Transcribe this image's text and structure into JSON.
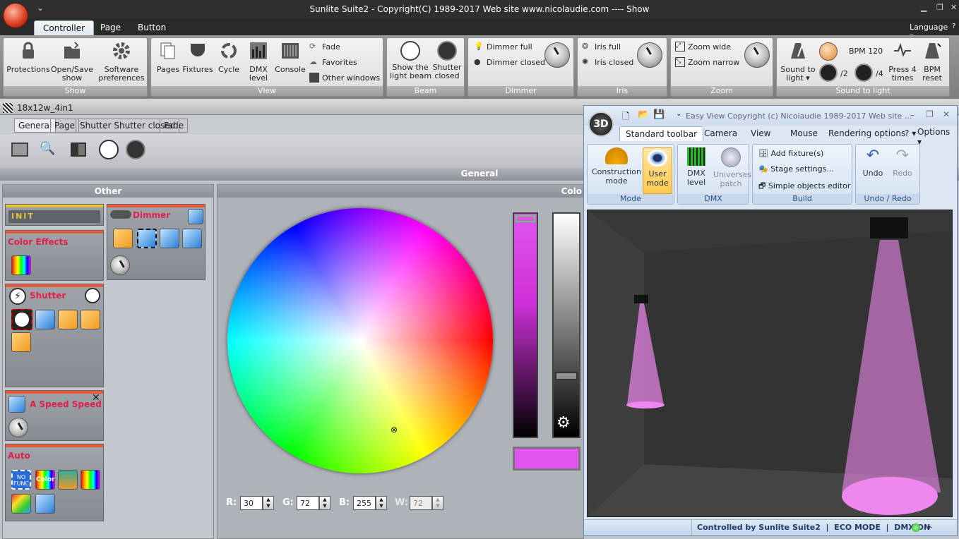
{
  "window_title": "Sunlite Suite2 - Copyright(C) 1989-2017    Web site www.nicolaudie.com ---- Show",
  "tabs": [
    "Controller",
    "Page",
    "Button"
  ],
  "language": "Language",
  "ribbon": {
    "show": {
      "label": "Show",
      "protections": "Protections",
      "open_save": "Open/Save\nshow",
      "software": "Software\npreferences"
    },
    "view": {
      "label": "View",
      "pages": "Pages",
      "fixtures": "Fixtures",
      "cycle": "Cycle",
      "dmx": "DMX\nlevel",
      "console": "Console",
      "fade": "Fade",
      "favorites": "Favorites",
      "other": "Other windows"
    },
    "beam": {
      "label": "Beam",
      "show_beam": "Show the\nlight beam",
      "shutter_closed": "Shutter\nclosed"
    },
    "dimmer": {
      "label": "Dimmer",
      "full": "Dimmer full",
      "closed": "Dimmer closed"
    },
    "iris": {
      "label": "Iris",
      "full": "Iris full",
      "closed": "Iris closed"
    },
    "zoom": {
      "label": "Zoom",
      "wide": "Zoom wide",
      "narrow": "Zoom narrow"
    },
    "sound": {
      "label": "Sound to light",
      "sound": "Sound to\nlight",
      "bpm": "BPM 120",
      "div2": "/2",
      "div4": "/4",
      "press": "Press 4\ntimes",
      "reset": "BPM\nreset"
    }
  },
  "fixture": {
    "name": "18x12w_4in1",
    "subtabs": [
      "General",
      "Page",
      "Shutter Shutter closed",
      "Fade"
    ],
    "general": "General",
    "other": "Other",
    "color_header": "Colo"
  },
  "panels": {
    "init": "INIT",
    "dimmer": "Dimmer",
    "color_effects": "Color Effects",
    "shutter": "Shutter",
    "speed": "A Speed Speed",
    "auto": "Auto",
    "nofunc": "NO\nFUNC",
    "color_icon": "Color"
  },
  "rgb": {
    "r_label": "R:",
    "g_label": "G:",
    "b_label": "B:",
    "w_label": "W:",
    "r": "30",
    "g": "72",
    "b": "255",
    "w": "72"
  },
  "easyview": {
    "title": "Easy View   Copyright (c) Nicolaudie 1989-2017   Web site ...",
    "logo": "3D",
    "tabs": [
      "Standard toolbar",
      "Camera",
      "View",
      "Mouse",
      "Rendering options"
    ],
    "help": "?",
    "options": "Options",
    "mode": {
      "label": "Mode",
      "construction": "Construction\nmode",
      "user": "User\nmode"
    },
    "dmx": {
      "label": "DMX",
      "level": "DMX\nlevel",
      "universes": "Universes\npatch"
    },
    "build": {
      "label": "Build",
      "add": "Add fixture(s)",
      "stage": "Stage settings...",
      "simple": "Simple objects editor"
    },
    "undo": {
      "label": "Undo / Redo",
      "undo": "Undo",
      "redo": "Redo"
    },
    "status": "Controlled by Sunlite Suite2  |  ECO MODE  |  DMX ON"
  },
  "colors": {
    "accent_red": "#e0204a",
    "selected_color": "#e055ee",
    "beam": "#ee88ee"
  }
}
